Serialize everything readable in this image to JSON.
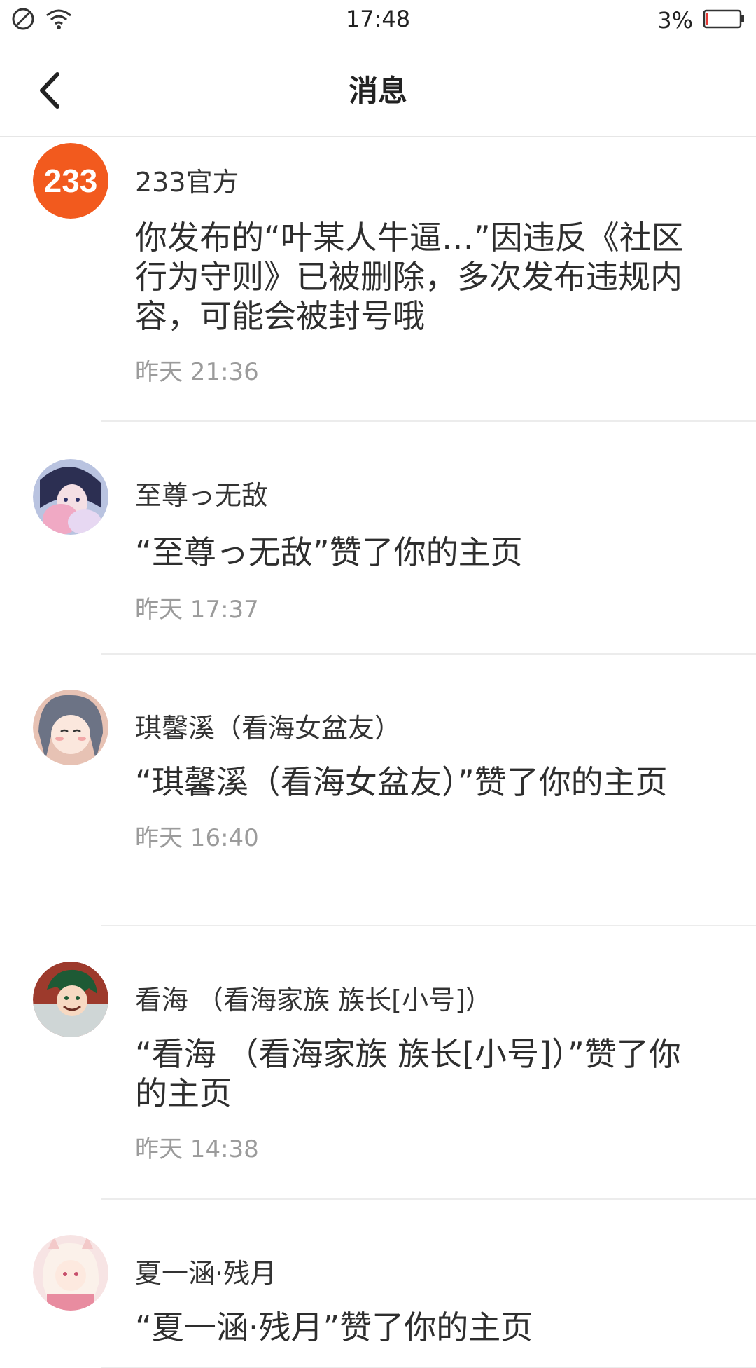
{
  "status_bar": {
    "time": "17:48",
    "battery": "3%",
    "icons": [
      "do-not-disturb-icon",
      "wifi-icon",
      "battery-icon"
    ],
    "battery_color": "#e53935"
  },
  "nav": {
    "title": "消息",
    "back_icon": "chevron-left-icon"
  },
  "messages": [
    {
      "sender": "233官方",
      "avatar": "233-logo",
      "avatar_text": "233",
      "avatar_color": "#f25a1e",
      "content": "你发布的“叶某人牛逼…”因违反《社区行为守则》已被删除，多次发布违规内容，可能会被封号哦",
      "time": "昨天 21:36"
    },
    {
      "sender": "至尊っ无敌",
      "avatar": "anime-avatar-dark-hair",
      "content": "“至尊っ无敌”赞了你的主页",
      "time": "昨天 17:37"
    },
    {
      "sender": "琪馨溪（看海女盆友）",
      "avatar": "anime-avatar-grey-hair",
      "content": "“琪馨溪（看海女盆友）”赞了你的主页",
      "time": "昨天 16:40"
    },
    {
      "sender": "看海 （看海家族 族长[小号]）",
      "avatar": "anime-avatar-green-hair",
      "content": "“看海 （看海家族 族长[小号]）”赞了你的主页",
      "time": "昨天 14:38"
    },
    {
      "sender": "夏一涵·残月",
      "avatar": "anime-avatar-pink",
      "content": "“夏一涵·残月”赞了你的主页",
      "time": ""
    }
  ]
}
